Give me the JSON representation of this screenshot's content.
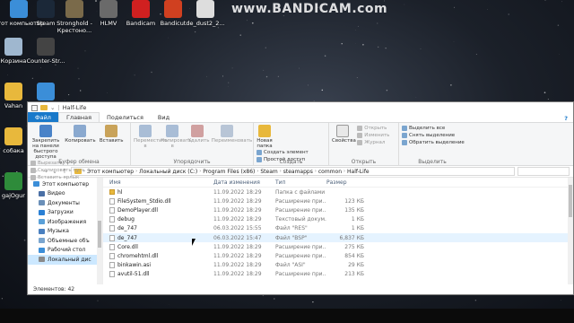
{
  "watermark": "www.BANDICAM.com",
  "desktop": {
    "icons": [
      {
        "label": "Этот компьютер",
        "icon": "computer-icon",
        "color": "#3b8ed8"
      },
      {
        "label": "Steam",
        "icon": "steam-icon",
        "color": "#1b2838"
      },
      {
        "label": "Stronghold - Крестоно...",
        "icon": "stronghold-icon",
        "color": "#7a6a4a"
      },
      {
        "label": "HLMV",
        "icon": "hlmv-icon",
        "color": "#6a6a6a"
      },
      {
        "label": "Bandicam",
        "icon": "bandicam-icon",
        "color": "#d02020"
      },
      {
        "label": "Bandicut",
        "icon": "bandicut-icon",
        "color": "#d04020"
      },
      {
        "label": "de_dust2_2...",
        "icon": "file-icon",
        "color": "#dddddd"
      },
      {
        "label": "Корзина",
        "icon": "recycle-bin-icon",
        "color": "#9fb7cf"
      },
      {
        "label": "Counter-Str...",
        "icon": "counter-strike-icon",
        "color": "#444444"
      },
      {
        "label": "Vahan",
        "icon": "folder-icon",
        "color": "#e8b83c"
      },
      {
        "label": "собака",
        "icon": "folder-icon",
        "color": "#e8b83c"
      },
      {
        "label": "gajOgur",
        "icon": "app-icon",
        "color": "#2e8b3a"
      },
      {
        "label": "",
        "icon": "image-icon",
        "color": "#3b8ed8"
      }
    ]
  },
  "window": {
    "title": "Half-Life",
    "tabs": {
      "file": "Файл",
      "home": "Главная",
      "share": "Поделиться",
      "view": "Вид"
    },
    "help": "?",
    "ribbon": {
      "clipboard": {
        "label": "Буфер обмена",
        "pin": "Закрепить на панели быстрого доступа",
        "copy": "Копировать",
        "paste": "Вставить",
        "cut": "Вырезать",
        "copy_path": "Скопировать путь",
        "paste_shortcut": "Вставить ярлык"
      },
      "organize": {
        "label": "Упорядочить",
        "move_to": "Переместить в",
        "copy_to": "Копировать в",
        "delete": "Удалить",
        "rename": "Переименовать"
      },
      "new": {
        "label": "Создать",
        "new_folder": "Новая папка",
        "new_item": "Создать элемент",
        "easy_access": "Простой доступ"
      },
      "open": {
        "label": "Открыть",
        "properties": "Свойства",
        "open": "Открыть",
        "edit": "Изменить",
        "history": "Журнал"
      },
      "select": {
        "label": "Выделить",
        "select_all": "Выделить все",
        "select_none": "Снять выделение",
        "invert": "Обратить выделение"
      }
    },
    "address": {
      "crumbs": [
        "Этот компьютер",
        "Локальный диск (C:)",
        "Program Files (x86)",
        "Steam",
        "steamapps",
        "common",
        "Half-Life"
      ]
    },
    "nav": {
      "items": [
        {
          "label": "Этот компьютер",
          "icon": "computer-icon",
          "color": "#3b8ed8"
        },
        {
          "label": "Видео",
          "icon": "video-icon",
          "color": "#4a6fa5"
        },
        {
          "label": "Документы",
          "icon": "documents-icon",
          "color": "#6a8fb8"
        },
        {
          "label": "Загрузки",
          "icon": "downloads-icon",
          "color": "#2a7fd4"
        },
        {
          "label": "Изображения",
          "icon": "pictures-icon",
          "color": "#5aa0d8"
        },
        {
          "label": "Музыка",
          "icon": "music-icon",
          "color": "#4a80c0"
        },
        {
          "label": "Объемные объ",
          "icon": "3d-objects-icon",
          "color": "#7aa5cf"
        },
        {
          "label": "Рабочий стол",
          "icon": "desktop-icon",
          "color": "#3b8ed8"
        },
        {
          "label": "Локальный дис",
          "icon": "drive-icon",
          "color": "#8a8a8a"
        }
      ]
    },
    "columns": {
      "name": "Имя",
      "date": "Дата изменения",
      "type": "Тип",
      "size": "Размер"
    },
    "files": [
      {
        "name": "hl",
        "date": "11.09.2022 18:29",
        "type": "Папка с файлами",
        "size": "",
        "kind": "folder"
      },
      {
        "name": "FileSystem_Stdio.dll",
        "date": "11.09.2022 18:29",
        "type": "Расширение при...",
        "size": "123 КБ",
        "kind": "file"
      },
      {
        "name": "DemoPlayer.dll",
        "date": "11.09.2022 18:29",
        "type": "Расширение при...",
        "size": "135 КБ",
        "kind": "file"
      },
      {
        "name": "debug",
        "date": "11.09.2022 18:29",
        "type": "Текстовый докум...",
        "size": "1 КБ",
        "kind": "file"
      },
      {
        "name": "de_747",
        "date": "06.03.2022 15:55",
        "type": "Файл \"RES\"",
        "size": "1 КБ",
        "kind": "file"
      },
      {
        "name": "de_747",
        "date": "06.03.2022 15:47",
        "type": "Файл \"BSP\"",
        "size": "6,837 КБ",
        "kind": "file"
      },
      {
        "name": "Core.dll",
        "date": "11.09.2022 18:29",
        "type": "Расширение при...",
        "size": "275 КБ",
        "kind": "file"
      },
      {
        "name": "chromehtml.dll",
        "date": "11.09.2022 18:29",
        "type": "Расширение при...",
        "size": "854 КБ",
        "kind": "file"
      },
      {
        "name": "binkawin.asi",
        "date": "11.09.2022 18:29",
        "type": "Файл \"ASI\"",
        "size": "29 КБ",
        "kind": "file"
      },
      {
        "name": "avutil-51.dll",
        "date": "11.09.2022 18:29",
        "type": "Расширение при...",
        "size": "213 КБ",
        "kind": "file"
      }
    ],
    "status": "Элементов: 42"
  }
}
